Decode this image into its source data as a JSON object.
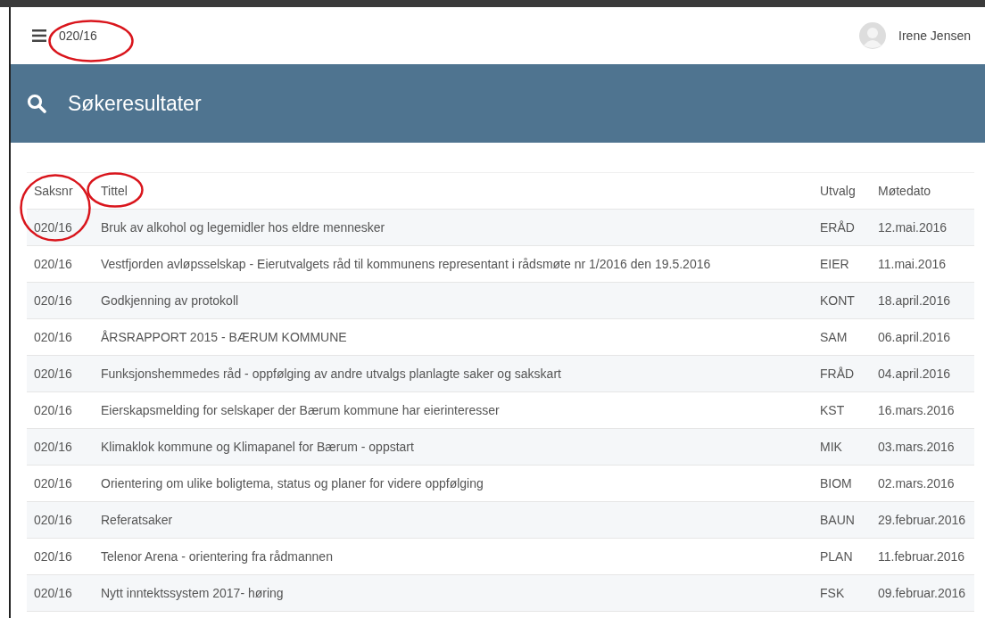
{
  "topbar": {
    "crumb": "020/16",
    "crumb_marked": true,
    "user": "Irene Jensen"
  },
  "header": {
    "title": "Søkeresultater"
  },
  "table": {
    "columns": [
      {
        "label": "Saksnr",
        "marked": true
      },
      {
        "label": "Tittel",
        "marked": true
      },
      {
        "label": "Utvalg",
        "marked": false
      },
      {
        "label": "Møtedato",
        "marked": false
      }
    ],
    "rows": [
      {
        "saksnr": "020/16",
        "tittel": "Bruk av alkohol og legemidler hos eldre mennesker",
        "utvalg": "ERÅD",
        "dato": "12.mai.2016"
      },
      {
        "saksnr": "020/16",
        "tittel": "Vestfjorden avløpsselskap - Eierutvalgets råd til kommunens representant i rådsmøte nr 1/2016 den 19.5.2016",
        "utvalg": "EIER",
        "dato": "11.mai.2016"
      },
      {
        "saksnr": "020/16",
        "tittel": "Godkjenning av protokoll",
        "utvalg": "KONT",
        "dato": "18.april.2016"
      },
      {
        "saksnr": "020/16",
        "tittel": "ÅRSRAPPORT 2015 - BÆRUM KOMMUNE",
        "utvalg": "SAM",
        "dato": "06.april.2016"
      },
      {
        "saksnr": "020/16",
        "tittel": "Funksjonshemmedes råd - oppfølging av andre utvalgs planlagte saker og sakskart",
        "utvalg": "FRÅD",
        "dato": "04.april.2016"
      },
      {
        "saksnr": "020/16",
        "tittel": "Eierskapsmelding for selskaper der Bærum kommune har eierinteresser",
        "utvalg": "KST",
        "dato": "16.mars.2016"
      },
      {
        "saksnr": "020/16",
        "tittel": "Klimaklok kommune og Klimapanel for Bærum - oppstart",
        "utvalg": "MIK",
        "dato": "03.mars.2016"
      },
      {
        "saksnr": "020/16",
        "tittel": "Orientering om ulike boligtema, status og planer for videre oppfølging",
        "utvalg": "BIOM",
        "dato": "02.mars.2016"
      },
      {
        "saksnr": "020/16",
        "tittel": "Referatsaker",
        "utvalg": "BAUN",
        "dato": "29.februar.2016"
      },
      {
        "saksnr": "020/16",
        "tittel": "Telenor Arena - orientering fra rådmannen",
        "utvalg": "PLAN",
        "dato": "11.februar.2016"
      },
      {
        "saksnr": "020/16",
        "tittel": "Nytt inntektssystem 2017- høring",
        "utvalg": "FSK",
        "dato": "09.februar.2016"
      }
    ]
  }
}
